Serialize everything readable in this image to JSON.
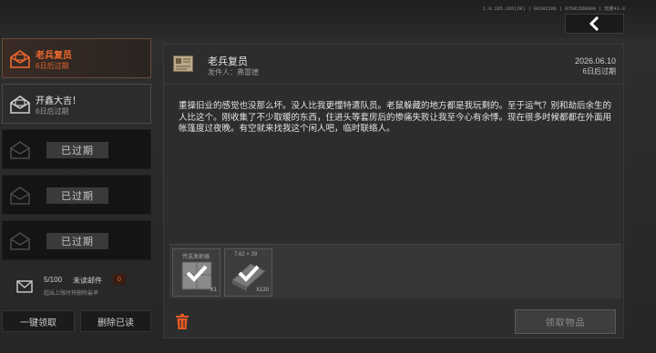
{
  "version": "1.0.165.165(20) | 06102206 | 87581569009 | 玩家41-3",
  "sidebar": {
    "mails": [
      {
        "title": "老兵复员",
        "sub": "6日后过期",
        "state": "active"
      },
      {
        "title": "开鑫大吉！",
        "sub": "6日后过期",
        "state": "read"
      },
      {
        "label": "已过期",
        "state": "expired"
      },
      {
        "label": "已过期",
        "state": "expired"
      },
      {
        "label": "已过期",
        "state": "expired"
      }
    ],
    "unread": {
      "count": "5/100",
      "label": "未读邮件",
      "badge": "0",
      "hint": "超出上限时将删除最早"
    },
    "one_click_claim": "一键领取",
    "delete_read": "删除已读"
  },
  "message": {
    "title": "老兵复员",
    "sender": "发件人：弗雷德",
    "date": "2026.06.10",
    "expire": "6日后过期",
    "body": "重操旧业的感觉也没那么坏。没人比我更懂特遣队员。老鼠躲藏的地方都是我玩剩的。至于运气？别和劫后余生的人比这个。刚收集了不少取暖的东西，住进头等套房后的惨痛失败让我至今心有余悸。现在很多时候都都在外面用帐篷度过夜晚。有空就来找我这个闲人吧，临时联络人。",
    "attachments": [
      {
        "name": "传送发射器",
        "qty": "X1",
        "icon": "crate-icon"
      },
      {
        "name": "7.62 × 39",
        "qty": "X120",
        "icon": "ammo-icon"
      }
    ],
    "claim_label": "领取物品"
  },
  "colors": {
    "accent": "#f06a2e",
    "background": "#2a2a2a"
  }
}
